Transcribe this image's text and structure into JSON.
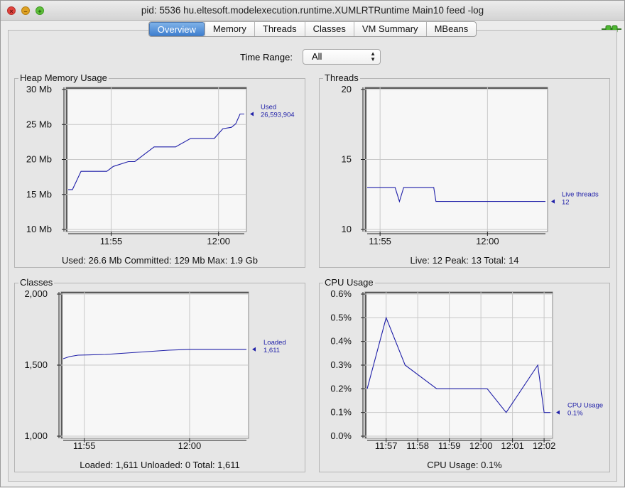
{
  "window": {
    "title": "pid: 5536 hu.eltesoft.modelexecution.runtime.XUMLRTRuntime Main10 feed -log"
  },
  "tabs": [
    {
      "label": "Overview",
      "active": true
    },
    {
      "label": "Memory"
    },
    {
      "label": "Threads"
    },
    {
      "label": "Classes"
    },
    {
      "label": "VM Summary"
    },
    {
      "label": "MBeans"
    }
  ],
  "time_range": {
    "label": "Time Range:",
    "value": "All"
  },
  "panels": {
    "heap": {
      "title": "Heap Memory Usage",
      "footer": "Used: 26.6 Mb    Committed: 129 Mb    Max: 1.9 Gb",
      "legend_name": "Used",
      "legend_value": "26,593,904"
    },
    "threads": {
      "title": "Threads",
      "footer": "Live: 12    Peak: 13    Total: 14",
      "legend_name": "Live threads",
      "legend_value": "12"
    },
    "classes": {
      "title": "Classes",
      "footer": "Loaded: 1,611    Unloaded: 0    Total: 1,611",
      "legend_name": "Loaded",
      "legend_value": "1,611"
    },
    "cpu": {
      "title": "CPU Usage",
      "footer": "CPU Usage: 0.1%",
      "legend_name": "CPU Usage",
      "legend_value": "0.1%"
    }
  },
  "colors": {
    "series": "#1f1fa8",
    "grid": "#c8c8c8",
    "plot_bg": "#f7f7f7"
  },
  "chart_data": [
    {
      "type": "line",
      "title": "Heap Memory Usage",
      "y_unit": "Mb",
      "ylim": [
        10,
        30
      ],
      "yticks": [
        "10 Mb",
        "15 Mb",
        "20 Mb",
        "25 Mb",
        "30 Mb"
      ],
      "ytick_values": [
        10,
        15,
        20,
        25,
        30
      ],
      "xlim": [
        "11:53",
        "12:01.2"
      ],
      "xticks": [
        "11:55",
        "12:00"
      ],
      "series": [
        {
          "name": "Used",
          "x": [
            "11:53",
            "11:53.2",
            "11:53.6",
            "11:54.8",
            "11:55.1",
            "11:55.8",
            "11:56.1",
            "11:57",
            "11:58",
            "11:58.7",
            "11:59.2",
            "11:59.8",
            "12:00.2",
            "12:00.6",
            "12:00.8",
            "12:01",
            "12:01.2"
          ],
          "values": [
            15.7,
            15.7,
            18.3,
            18.3,
            19.0,
            19.7,
            19.7,
            21.8,
            21.8,
            23.0,
            23.0,
            23.0,
            24.4,
            24.6,
            25.1,
            26.5,
            26.5
          ]
        }
      ]
    },
    {
      "type": "line",
      "title": "Threads",
      "ylim": [
        10,
        20
      ],
      "yticks": [
        "10",
        "15",
        "20"
      ],
      "ytick_values": [
        10,
        15,
        20
      ],
      "xlim": [
        "11:54.4",
        "12:02.7"
      ],
      "xticks": [
        "11:55",
        "12:00"
      ],
      "series": [
        {
          "name": "Live threads",
          "x": [
            "11:54.4",
            "11:55.7",
            "11:55.9",
            "11:56.1",
            "11:57.5",
            "11:57.6",
            "12:02.7"
          ],
          "values": [
            13,
            13,
            12,
            13,
            13,
            12,
            12
          ]
        }
      ]
    },
    {
      "type": "line",
      "title": "Classes",
      "ylim": [
        1000,
        2000
      ],
      "yticks": [
        "1,000",
        "1,500",
        "2,000"
      ],
      "ytick_values": [
        1000,
        1500,
        2000
      ],
      "xlim": [
        "11:54",
        "12:02.7"
      ],
      "xticks": [
        "11:55",
        "12:00"
      ],
      "series": [
        {
          "name": "Loaded",
          "x": [
            "11:54",
            "11:54.3",
            "11:54.7",
            "11:56",
            "11:57",
            "11:58",
            "11:59",
            "12:00",
            "12:02.7"
          ],
          "values": [
            1545,
            1560,
            1570,
            1575,
            1585,
            1595,
            1605,
            1611,
            1611
          ]
        }
      ]
    },
    {
      "type": "line",
      "title": "CPU Usage",
      "y_unit": "%",
      "ylim": [
        0,
        0.6
      ],
      "yticks": [
        "0.0%",
        "0.1%",
        "0.2%",
        "0.3%",
        "0.4%",
        "0.5%",
        "0.6%"
      ],
      "ytick_values": [
        0,
        0.1,
        0.2,
        0.3,
        0.4,
        0.5,
        0.6
      ],
      "xlim": [
        "11:56.4",
        "12:02.2"
      ],
      "xticks": [
        "11:57",
        "11:58",
        "11:59",
        "12:00",
        "12:01",
        "12:02"
      ],
      "series": [
        {
          "name": "CPU Usage",
          "x": [
            "11:56.4",
            "11:57",
            "11:57.6",
            "11:58.6",
            "12:00.2",
            "12:00.8",
            "12:01.8",
            "12:02",
            "12:02.2"
          ],
          "values": [
            0.2,
            0.5,
            0.3,
            0.2,
            0.2,
            0.1,
            0.3,
            0.1,
            0.1
          ]
        }
      ]
    }
  ]
}
